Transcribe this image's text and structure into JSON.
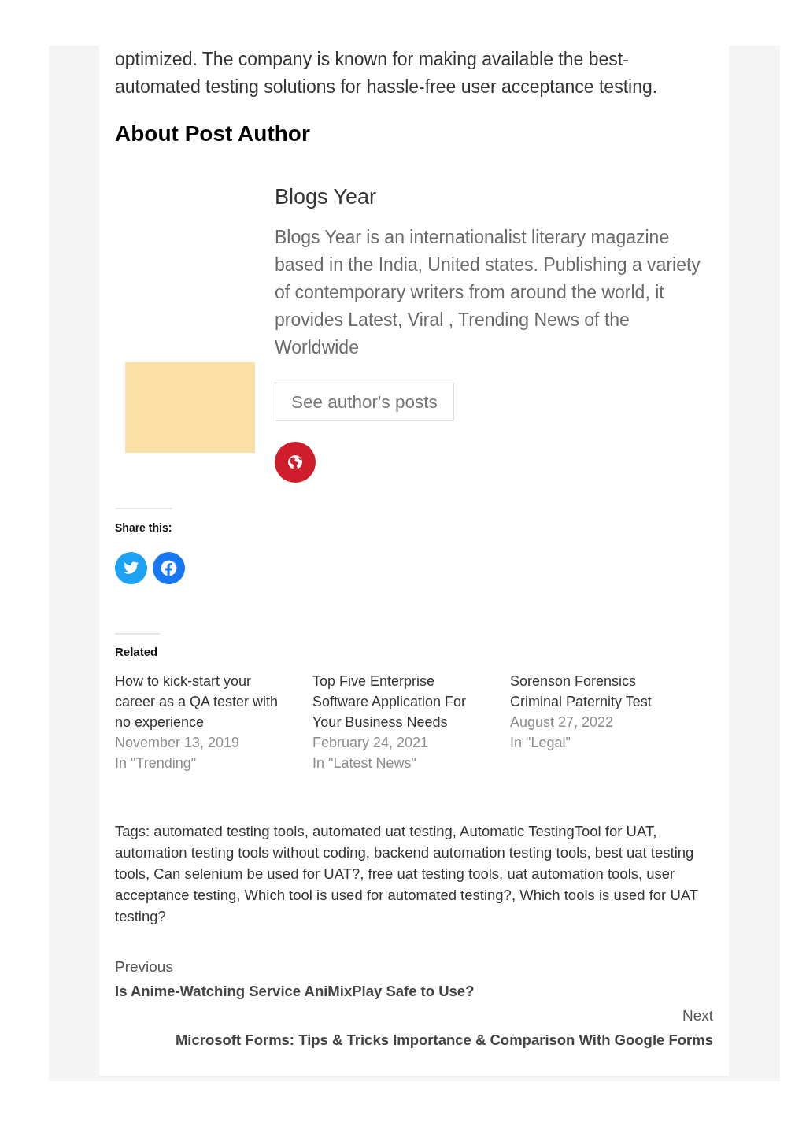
{
  "article_end": {
    "paragraph": "optimized. The company is known for making available the best-automated testing solutions for hassle-free user acceptance testing."
  },
  "author_section": {
    "heading": "About Post Author",
    "name": "Blogs Year",
    "bio": "Blogs Year is an internationalist literary magazine based in the India, United states. Publishing a variety of contemporary writers from around the world, it provides Latest, Viral , Trending News of the Worldwide",
    "posts_button": "See author's posts",
    "links": [
      {
        "kind": "website"
      }
    ]
  },
  "share": {
    "heading": "Share this:",
    "buttons": [
      {
        "kind": "twitter"
      },
      {
        "kind": "facebook"
      }
    ]
  },
  "related": {
    "heading": "Related",
    "posts": [
      {
        "title": "How to kick-start your career as a QA tester with no experience",
        "date": "November 13, 2019",
        "category": "In \"Trending\""
      },
      {
        "title": "Top Five Enterprise Software Application For Your Business Needs",
        "date": "February 24, 2021",
        "category": "In \"Latest News\""
      },
      {
        "title": "Sorenson Forensics Criminal Paternity Test",
        "date": "August 27, 2022",
        "category": "In \"Legal\""
      }
    ]
  },
  "tags": "Tags: automated testing tools, automated uat testing, Automatic TestingTool for UAT, automation testing tools without coding, backend automation testing tools, best uat testing tools, Can selenium be used for UAT?, free uat testing tools, uat automation tools, user acceptance testing, Which tool is used for automated testing?, Which tools is used for UAT testing?",
  "post_navigation": {
    "previous": {
      "label": "Previous",
      "title": "Is Anime-Watching Service AniMixPlay Safe to Use?"
    },
    "next": {
      "label": "Next",
      "title": "Microsoft Forms: Tips & Tricks Importance & Comparison With Google Forms"
    }
  }
}
